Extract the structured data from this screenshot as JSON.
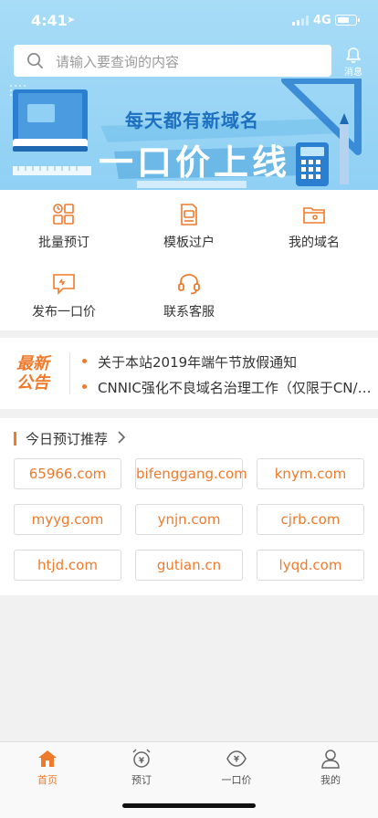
{
  "status": {
    "time": "4:41",
    "network": "4G"
  },
  "search": {
    "placeholder": "请输入要查询的内容"
  },
  "messages": {
    "label": "消息"
  },
  "banner": {
    "line1": "每天都有新域名",
    "line2": "一口价上线"
  },
  "menu": {
    "items": [
      {
        "label": "批量预订",
        "icon": "grid-icon"
      },
      {
        "label": "模板过户",
        "icon": "document-icon"
      },
      {
        "label": "我的域名",
        "icon": "folder-icon"
      },
      {
        "label": "发布一口价",
        "icon": "chat-icon"
      },
      {
        "label": "联系客服",
        "icon": "headset-icon"
      }
    ]
  },
  "notice": {
    "badge_line1": "最新",
    "badge_line2": "公告",
    "items": [
      "关于本站2019年端午节放假通知",
      "CNNIC强化不良域名治理工作（仅限于CN/中国域名）"
    ]
  },
  "recommend": {
    "title": "今日预订推荐",
    "domains": [
      "65966.com",
      "bifenggang.com",
      "knym.com",
      "myyg.com",
      "ynjn.com",
      "cjrb.com",
      "htjd.com",
      "gutian.cn",
      "lyqd.com"
    ]
  },
  "tabbar": {
    "items": [
      {
        "label": "首页",
        "icon": "home-icon",
        "active": true
      },
      {
        "label": "预订",
        "icon": "alarm-clock-icon",
        "active": false
      },
      {
        "label": "一口价",
        "icon": "price-tag-icon",
        "active": false
      },
      {
        "label": "我的",
        "icon": "user-icon",
        "active": false
      }
    ]
  },
  "colors": {
    "accent": "#f07a2c",
    "banner": "#a8dcf7",
    "banner_title": "#1d6fc0"
  }
}
